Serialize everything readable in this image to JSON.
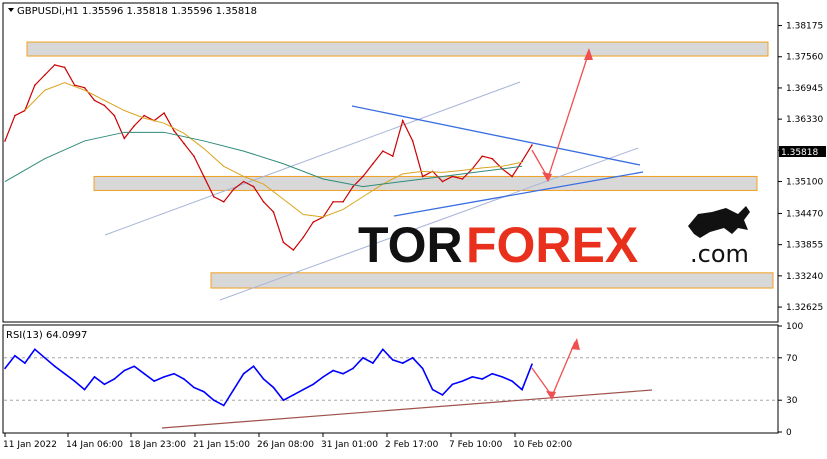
{
  "chart_data": [
    {
      "type": "line",
      "header": "GBPUSDi,H1  1.35596  1.35818  1.35596  1.35818",
      "current_price": "1.35818",
      "y_ticks": [
        "1.38175",
        "1.37560",
        "1.36945",
        "1.36330",
        "1.35715",
        "1.35100",
        "1.34470",
        "1.33855",
        "1.33240",
        "1.32625"
      ],
      "ylim": [
        1.3235,
        1.386
      ],
      "x_ticks": [
        "11 Jan 2022",
        "14 Jan 06:00",
        "18 Jan 23:00",
        "21 Jan 15:00",
        "26 Jan 08:00",
        "31 Jan 01:00",
        "2 Feb 17:00",
        "7 Feb 10:00",
        "10 Feb 02:00"
      ],
      "series": [
        {
          "color": "#cc0000",
          "x": [
            0,
            10,
            20,
            30,
            40,
            50,
            60,
            70,
            80,
            90,
            100,
            110,
            120,
            130,
            140,
            150,
            160,
            170,
            180,
            190,
            200,
            210,
            220,
            230,
            240,
            250,
            260,
            270,
            280,
            290,
            300,
            310,
            320,
            330,
            340,
            350,
            360,
            370,
            380,
            390,
            400,
            410,
            420,
            430,
            440,
            450,
            460,
            470,
            480,
            490,
            500,
            510,
            520,
            530
          ],
          "values": [
            1.359,
            1.364,
            1.365,
            1.37,
            1.372,
            1.374,
            1.3735,
            1.37,
            1.3695,
            1.367,
            1.366,
            1.364,
            1.3595,
            1.362,
            1.364,
            1.363,
            1.3645,
            1.361,
            1.3585,
            1.356,
            1.352,
            1.348,
            1.347,
            1.3495,
            1.351,
            1.35,
            1.347,
            1.345,
            1.339,
            1.3375,
            1.34,
            1.343,
            1.344,
            1.347,
            1.347,
            1.35,
            1.352,
            1.3545,
            1.357,
            1.356,
            1.363,
            1.359,
            1.352,
            1.353,
            1.351,
            1.352,
            1.3515,
            1.3535,
            1.356,
            1.3555,
            1.3535,
            1.352,
            1.355,
            1.3582
          ]
        },
        {
          "color": "#daa520",
          "x": [
            20,
            40,
            60,
            80,
            100,
            120,
            140,
            160,
            180,
            200,
            220,
            240,
            260,
            280,
            300,
            320,
            340,
            360,
            380,
            400,
            420,
            440,
            460,
            480,
            500,
            520
          ],
          "values": [
            1.365,
            1.369,
            1.3705,
            1.369,
            1.367,
            1.365,
            1.3635,
            1.3625,
            1.3605,
            1.3575,
            1.354,
            1.352,
            1.3505,
            1.3475,
            1.3445,
            1.344,
            1.3455,
            1.348,
            1.3505,
            1.3525,
            1.353,
            1.3528,
            1.3532,
            1.3537,
            1.354,
            1.3548
          ]
        },
        {
          "color": "#2e8b7a",
          "x": [
            0,
            40,
            80,
            120,
            160,
            200,
            240,
            280,
            320,
            360,
            400,
            440,
            480,
            520
          ],
          "values": [
            1.351,
            1.3555,
            1.359,
            1.3607,
            1.3607,
            1.359,
            1.357,
            1.3545,
            1.3515,
            1.35,
            1.351,
            1.352,
            1.353,
            1.354
          ]
        }
      ],
      "zones": [
        {
          "from": 1.376,
          "to": 1.3785
        },
        {
          "from": 1.35,
          "to": 1.352
        },
        {
          "from": 1.33,
          "to": 1.333
        }
      ]
    },
    {
      "type": "line",
      "label": "RSI(13) 64.0997",
      "y_ticks": [
        "100",
        "70",
        "30",
        "0"
      ],
      "ylim": [
        0,
        100
      ],
      "series": [
        {
          "color": "#0000ff",
          "x": [
            0,
            10,
            20,
            30,
            40,
            50,
            60,
            70,
            80,
            90,
            100,
            110,
            120,
            130,
            140,
            150,
            160,
            170,
            180,
            190,
            200,
            210,
            220,
            230,
            240,
            250,
            260,
            270,
            280,
            290,
            300,
            310,
            320,
            330,
            340,
            350,
            360,
            370,
            380,
            390,
            400,
            410,
            420,
            430,
            440,
            450,
            460,
            470,
            480,
            490,
            500,
            510,
            520,
            530
          ],
          "values": [
            60,
            72,
            65,
            78,
            70,
            62,
            55,
            48,
            40,
            52,
            45,
            50,
            58,
            62,
            55,
            48,
            52,
            55,
            50,
            42,
            38,
            30,
            25,
            40,
            55,
            62,
            50,
            42,
            30,
            35,
            40,
            45,
            52,
            58,
            55,
            60,
            70,
            65,
            78,
            68,
            65,
            70,
            60,
            40,
            35,
            45,
            48,
            52,
            50,
            55,
            52,
            48,
            40,
            64
          ]
        }
      ]
    }
  ],
  "brand": {
    "tor": "TOR",
    "forex": "FOREX",
    "com": ".com"
  }
}
